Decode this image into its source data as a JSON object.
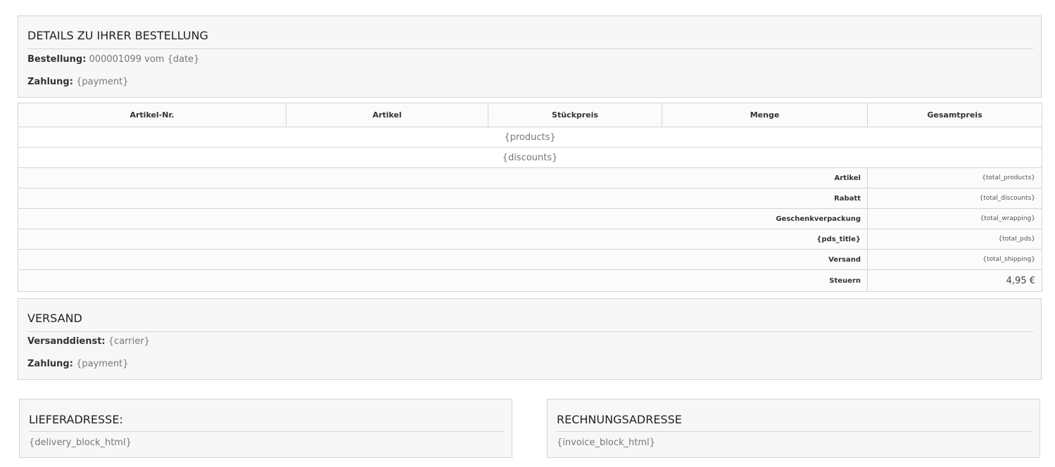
{
  "order_details": {
    "title": "DETAILS ZU IHRER BESTELLUNG",
    "order_label": "Bestellung:",
    "order_value": "000001099 vom {date}",
    "payment_label": "Zahlung:",
    "payment_value": "{payment}"
  },
  "table": {
    "headers": [
      "Artikel-Nr.",
      "Artikel",
      "Stückpreis",
      "Menge",
      "Gesamtpreis"
    ],
    "products_placeholder": "{products}",
    "discounts_placeholder": "{discounts}",
    "summary": [
      {
        "label": "Artikel",
        "value": "{total_products}"
      },
      {
        "label": "Rabatt",
        "value": "{total_discounts}"
      },
      {
        "label": "Geschenkverpackung",
        "value": "{total_wrapping}"
      },
      {
        "label": "{pds_title}",
        "value": "{total_pds}"
      },
      {
        "label": "Versand",
        "value": "{total_shipping}"
      },
      {
        "label": "Steuern",
        "value": "4,95 €"
      }
    ]
  },
  "shipping": {
    "title": "VERSAND",
    "carrier_label": "Versanddienst:",
    "carrier_value": "{carrier}",
    "payment_label": "Zahlung:",
    "payment_value": "{payment}"
  },
  "delivery_address": {
    "title": "LIEFERADRESSE:",
    "value": "{delivery_block_html}"
  },
  "invoice_address": {
    "title": "RECHNUNGSADRESSE",
    "value": "{invoice_block_html}"
  }
}
